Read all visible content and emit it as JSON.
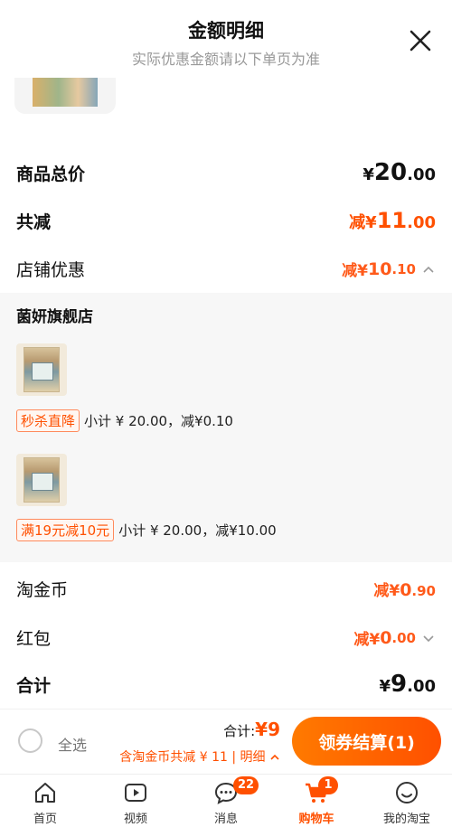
{
  "header": {
    "title": "金额明细",
    "subtitle": "实际优惠金额请以下单页为准"
  },
  "summary": {
    "goods_total_label": "商品总价",
    "goods_total_yen": "¥",
    "goods_total_int": "20",
    "goods_total_dec": ".00",
    "total_reduce_label": "共减",
    "total_reduce_prefix": "减¥",
    "total_reduce_int": "11",
    "total_reduce_dec": ".00",
    "shop_discount_label": "店铺优惠",
    "shop_discount_prefix": "减¥",
    "shop_discount_int": "10",
    "shop_discount_dec": ".10"
  },
  "shop": {
    "name": "菌妍旗舰店",
    "items": [
      {
        "tag": "秒杀直降",
        "detail": "小计 ¥ 20.00，减¥0.10"
      },
      {
        "tag": "满19元减10元",
        "detail": "小计 ¥ 20.00，减¥10.00"
      }
    ]
  },
  "extras": {
    "coin_label": "淘金币",
    "coin_prefix": "减¥",
    "coin_int": "0",
    "coin_dec": ".90",
    "redpacket_label": "红包",
    "redpacket_prefix": "减¥",
    "redpacket_int": "0",
    "redpacket_dec": ".00",
    "total_label": "合计",
    "total_yen": "¥",
    "total_int": "9",
    "total_dec": ".00"
  },
  "bottom": {
    "select_all": "全选",
    "total_prefix": "合计:",
    "total_amount": "¥9",
    "reduce_text": "含淘金币共减 ¥ 11 | 明细",
    "checkout_label": "领券结算(1)"
  },
  "tabs": [
    {
      "label": "首页",
      "icon": "home-icon"
    },
    {
      "label": "视频",
      "icon": "video-icon"
    },
    {
      "label": "消息",
      "icon": "message-icon",
      "badge": "22"
    },
    {
      "label": "购物车",
      "icon": "cart-icon",
      "badge": "1"
    },
    {
      "label": "我的淘宝",
      "icon": "profile-icon"
    }
  ],
  "colors": {
    "accent": "#ff5000",
    "muted": "#999999",
    "panel": "#f7f7f7"
  }
}
